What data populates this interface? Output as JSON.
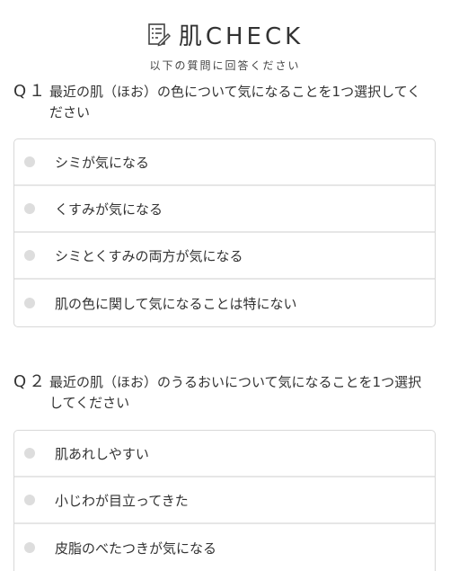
{
  "header": {
    "title": "肌CHECK",
    "subtitle": "以下の質問に回答ください",
    "icon": "checklist-pen-icon"
  },
  "questions": [
    {
      "number": "Q１",
      "text": "最近の肌（ほお）の色について気になることを1つ選択してください",
      "options": [
        "シミが気になる",
        "くすみが気になる",
        "シミとくすみの両方が気になる",
        "肌の色に関して気になることは特にない"
      ]
    },
    {
      "number": "Q２",
      "text": "最近の肌（ほお）のうるおいについて気になることを1つ選択してください",
      "options": [
        "肌あれしやすい",
        "小じわが目立ってきた",
        "皮脂のべたつきが気になる"
      ]
    }
  ]
}
